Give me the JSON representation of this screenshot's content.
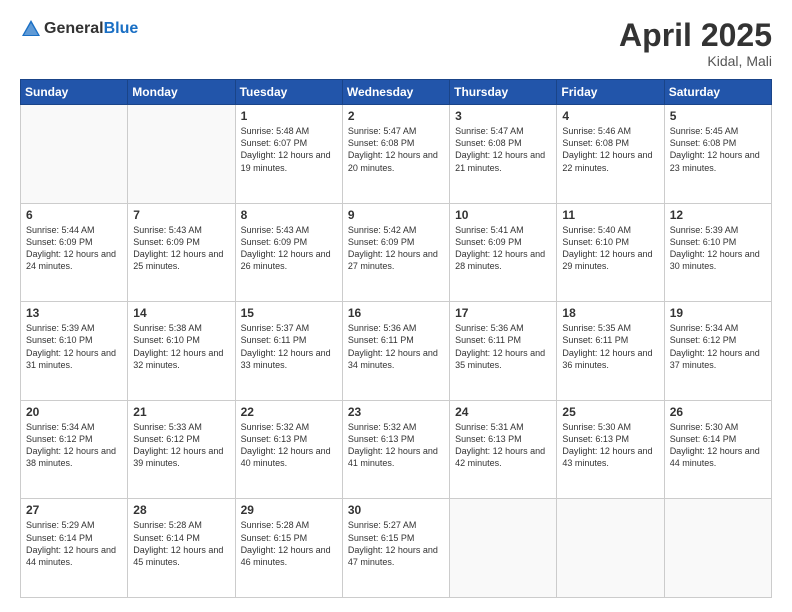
{
  "header": {
    "logo_line1": "General",
    "logo_line2": "Blue",
    "title": "April 2025",
    "location": "Kidal, Mali"
  },
  "days_of_week": [
    "Sunday",
    "Monday",
    "Tuesday",
    "Wednesday",
    "Thursday",
    "Friday",
    "Saturday"
  ],
  "weeks": [
    [
      {
        "day": "",
        "sunrise": "",
        "sunset": "",
        "daylight": ""
      },
      {
        "day": "",
        "sunrise": "",
        "sunset": "",
        "daylight": ""
      },
      {
        "day": "1",
        "sunrise": "Sunrise: 5:48 AM",
        "sunset": "Sunset: 6:07 PM",
        "daylight": "Daylight: 12 hours and 19 minutes."
      },
      {
        "day": "2",
        "sunrise": "Sunrise: 5:47 AM",
        "sunset": "Sunset: 6:08 PM",
        "daylight": "Daylight: 12 hours and 20 minutes."
      },
      {
        "day": "3",
        "sunrise": "Sunrise: 5:47 AM",
        "sunset": "Sunset: 6:08 PM",
        "daylight": "Daylight: 12 hours and 21 minutes."
      },
      {
        "day": "4",
        "sunrise": "Sunrise: 5:46 AM",
        "sunset": "Sunset: 6:08 PM",
        "daylight": "Daylight: 12 hours and 22 minutes."
      },
      {
        "day": "5",
        "sunrise": "Sunrise: 5:45 AM",
        "sunset": "Sunset: 6:08 PM",
        "daylight": "Daylight: 12 hours and 23 minutes."
      }
    ],
    [
      {
        "day": "6",
        "sunrise": "Sunrise: 5:44 AM",
        "sunset": "Sunset: 6:09 PM",
        "daylight": "Daylight: 12 hours and 24 minutes."
      },
      {
        "day": "7",
        "sunrise": "Sunrise: 5:43 AM",
        "sunset": "Sunset: 6:09 PM",
        "daylight": "Daylight: 12 hours and 25 minutes."
      },
      {
        "day": "8",
        "sunrise": "Sunrise: 5:43 AM",
        "sunset": "Sunset: 6:09 PM",
        "daylight": "Daylight: 12 hours and 26 minutes."
      },
      {
        "day": "9",
        "sunrise": "Sunrise: 5:42 AM",
        "sunset": "Sunset: 6:09 PM",
        "daylight": "Daylight: 12 hours and 27 minutes."
      },
      {
        "day": "10",
        "sunrise": "Sunrise: 5:41 AM",
        "sunset": "Sunset: 6:09 PM",
        "daylight": "Daylight: 12 hours and 28 minutes."
      },
      {
        "day": "11",
        "sunrise": "Sunrise: 5:40 AM",
        "sunset": "Sunset: 6:10 PM",
        "daylight": "Daylight: 12 hours and 29 minutes."
      },
      {
        "day": "12",
        "sunrise": "Sunrise: 5:39 AM",
        "sunset": "Sunset: 6:10 PM",
        "daylight": "Daylight: 12 hours and 30 minutes."
      }
    ],
    [
      {
        "day": "13",
        "sunrise": "Sunrise: 5:39 AM",
        "sunset": "Sunset: 6:10 PM",
        "daylight": "Daylight: 12 hours and 31 minutes."
      },
      {
        "day": "14",
        "sunrise": "Sunrise: 5:38 AM",
        "sunset": "Sunset: 6:10 PM",
        "daylight": "Daylight: 12 hours and 32 minutes."
      },
      {
        "day": "15",
        "sunrise": "Sunrise: 5:37 AM",
        "sunset": "Sunset: 6:11 PM",
        "daylight": "Daylight: 12 hours and 33 minutes."
      },
      {
        "day": "16",
        "sunrise": "Sunrise: 5:36 AM",
        "sunset": "Sunset: 6:11 PM",
        "daylight": "Daylight: 12 hours and 34 minutes."
      },
      {
        "day": "17",
        "sunrise": "Sunrise: 5:36 AM",
        "sunset": "Sunset: 6:11 PM",
        "daylight": "Daylight: 12 hours and 35 minutes."
      },
      {
        "day": "18",
        "sunrise": "Sunrise: 5:35 AM",
        "sunset": "Sunset: 6:11 PM",
        "daylight": "Daylight: 12 hours and 36 minutes."
      },
      {
        "day": "19",
        "sunrise": "Sunrise: 5:34 AM",
        "sunset": "Sunset: 6:12 PM",
        "daylight": "Daylight: 12 hours and 37 minutes."
      }
    ],
    [
      {
        "day": "20",
        "sunrise": "Sunrise: 5:34 AM",
        "sunset": "Sunset: 6:12 PM",
        "daylight": "Daylight: 12 hours and 38 minutes."
      },
      {
        "day": "21",
        "sunrise": "Sunrise: 5:33 AM",
        "sunset": "Sunset: 6:12 PM",
        "daylight": "Daylight: 12 hours and 39 minutes."
      },
      {
        "day": "22",
        "sunrise": "Sunrise: 5:32 AM",
        "sunset": "Sunset: 6:13 PM",
        "daylight": "Daylight: 12 hours and 40 minutes."
      },
      {
        "day": "23",
        "sunrise": "Sunrise: 5:32 AM",
        "sunset": "Sunset: 6:13 PM",
        "daylight": "Daylight: 12 hours and 41 minutes."
      },
      {
        "day": "24",
        "sunrise": "Sunrise: 5:31 AM",
        "sunset": "Sunset: 6:13 PM",
        "daylight": "Daylight: 12 hours and 42 minutes."
      },
      {
        "day": "25",
        "sunrise": "Sunrise: 5:30 AM",
        "sunset": "Sunset: 6:13 PM",
        "daylight": "Daylight: 12 hours and 43 minutes."
      },
      {
        "day": "26",
        "sunrise": "Sunrise: 5:30 AM",
        "sunset": "Sunset: 6:14 PM",
        "daylight": "Daylight: 12 hours and 44 minutes."
      }
    ],
    [
      {
        "day": "27",
        "sunrise": "Sunrise: 5:29 AM",
        "sunset": "Sunset: 6:14 PM",
        "daylight": "Daylight: 12 hours and 44 minutes."
      },
      {
        "day": "28",
        "sunrise": "Sunrise: 5:28 AM",
        "sunset": "Sunset: 6:14 PM",
        "daylight": "Daylight: 12 hours and 45 minutes."
      },
      {
        "day": "29",
        "sunrise": "Sunrise: 5:28 AM",
        "sunset": "Sunset: 6:15 PM",
        "daylight": "Daylight: 12 hours and 46 minutes."
      },
      {
        "day": "30",
        "sunrise": "Sunrise: 5:27 AM",
        "sunset": "Sunset: 6:15 PM",
        "daylight": "Daylight: 12 hours and 47 minutes."
      },
      {
        "day": "",
        "sunrise": "",
        "sunset": "",
        "daylight": ""
      },
      {
        "day": "",
        "sunrise": "",
        "sunset": "",
        "daylight": ""
      },
      {
        "day": "",
        "sunrise": "",
        "sunset": "",
        "daylight": ""
      }
    ]
  ]
}
